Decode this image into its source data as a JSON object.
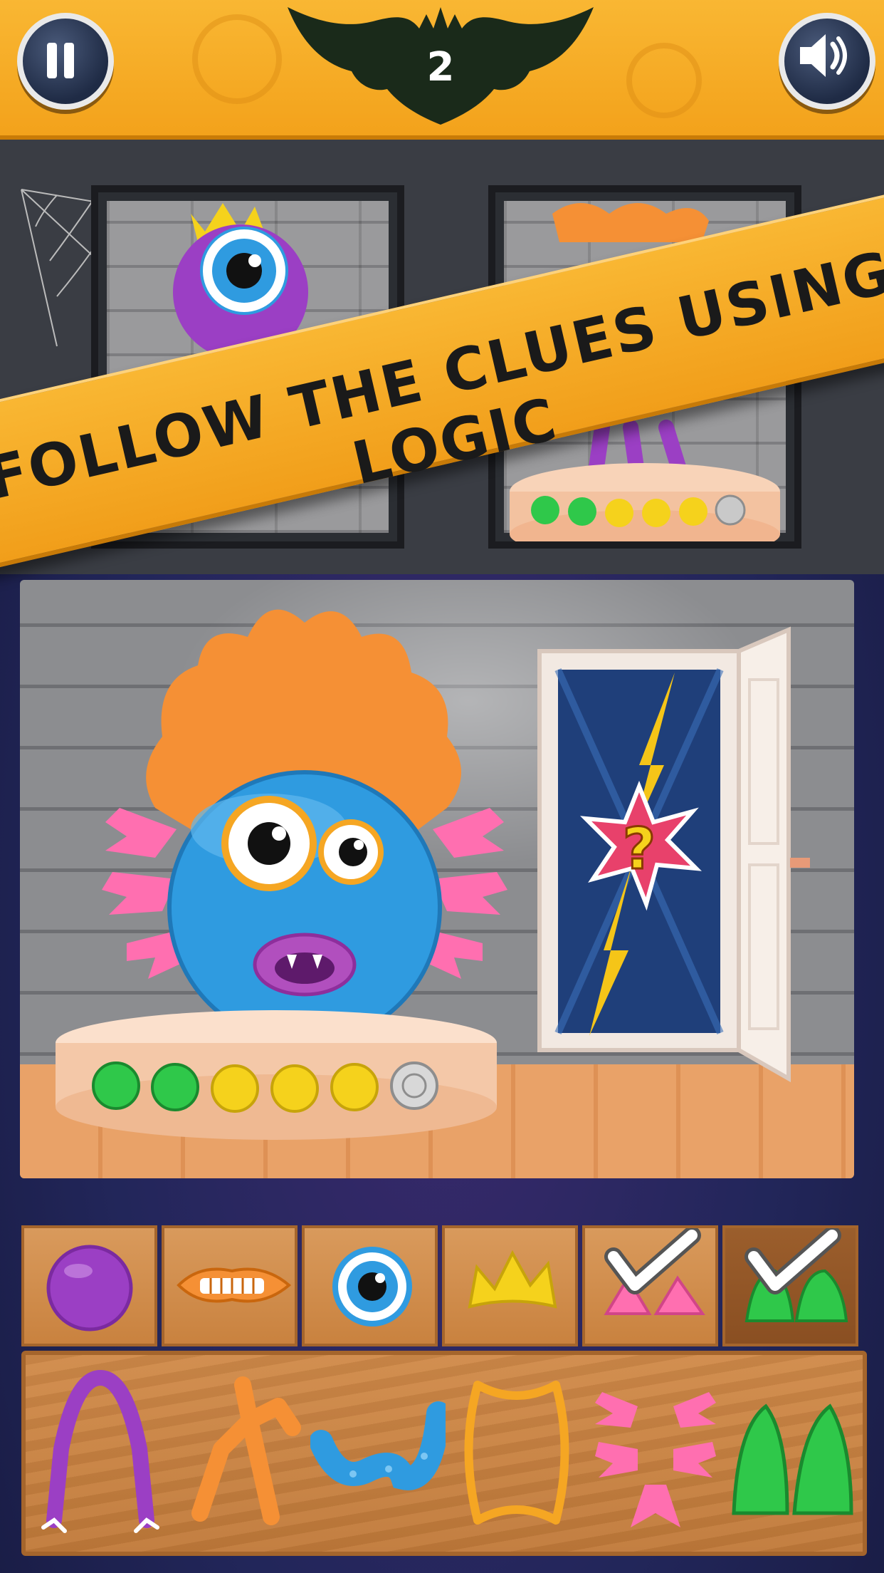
{
  "hud": {
    "level": "2",
    "pause_icon": "pause-icon",
    "sound_icon": "speaker-icon"
  },
  "banner": {
    "text": "FOLLOW THE CLUES USING LOGIC"
  },
  "colors": {
    "orange": "#f5a623",
    "blue_monster": "#2f9be0",
    "purple": "#9b3fc4",
    "pink": "#ff6fb0",
    "green": "#2fc84a",
    "yellow": "#f5d21c"
  },
  "clue_monsters": [
    {
      "body": "purple",
      "eye": "single-eye",
      "top": "yellow-crown"
    },
    {
      "body": "orange",
      "limbs": "purple",
      "indicators": [
        "green",
        "green",
        "yellow",
        "yellow",
        "yellow",
        "gray"
      ]
    }
  ],
  "current_monster": {
    "body": "blue",
    "hair": "orange-spiky",
    "arms": "pink-claws",
    "legs": "purple",
    "indicators": [
      "green",
      "green",
      "yellow",
      "yellow",
      "yellow",
      "gray"
    ]
  },
  "door": {
    "icon": "question-mark-icon"
  },
  "tray_slots": [
    {
      "part": "purple-body",
      "checked": false
    },
    {
      "part": "orange-mouth",
      "checked": false
    },
    {
      "part": "blue-eye",
      "checked": false
    },
    {
      "part": "yellow-crown",
      "checked": false
    },
    {
      "part": "pink-feet",
      "checked": true
    },
    {
      "part": "green-feet",
      "checked": true
    }
  ],
  "parts": [
    "purple-legs",
    "orange-legs",
    "blue-tentacle",
    "orange-outline-body",
    "pink-claws",
    "green-feet"
  ]
}
